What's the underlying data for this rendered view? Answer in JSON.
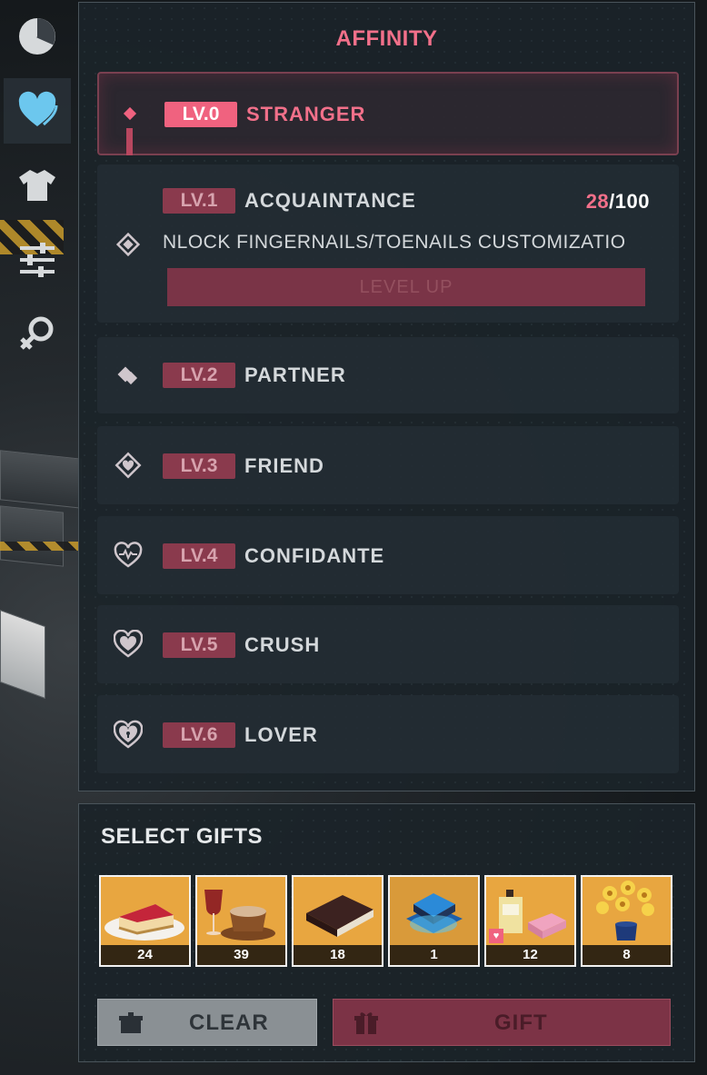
{
  "panel": {
    "title": "AFFINITY",
    "progress": {
      "current": "28",
      "max": "/100"
    },
    "levels": [
      {
        "badge": "LV.0",
        "name": "STRANGER",
        "icon": "diamond-dot-icon",
        "current": true
      },
      {
        "badge": "LV.1",
        "name": "ACQUAINTANCE",
        "icon": "diamond-icon",
        "unlock": "NLOCK FINGERNAILS/TOENAILS CUSTOMIZATIO",
        "button": "LEVEL UP"
      },
      {
        "badge": "LV.2",
        "name": "PARTNER",
        "icon": "split-diamond-icon"
      },
      {
        "badge": "LV.3",
        "name": "FRIEND",
        "icon": "heart-diamond-icon"
      },
      {
        "badge": "LV.4",
        "name": "CONFIDANTE",
        "icon": "heartbeat-icon"
      },
      {
        "badge": "LV.5",
        "name": "CRUSH",
        "icon": "double-heart-icon"
      },
      {
        "badge": "LV.6",
        "name": "LOVER",
        "icon": "heart-lock-icon"
      }
    ]
  },
  "sidebar": {
    "items": [
      {
        "icon": "pie-chart-icon"
      },
      {
        "icon": "heart-icon",
        "active": true
      },
      {
        "icon": "shirt-icon"
      },
      {
        "icon": "sliders-icon"
      },
      {
        "icon": "gender-icon"
      }
    ]
  },
  "gifts": {
    "title": "SELECT GIFTS",
    "items": [
      {
        "name": "cheesecake",
        "count": "24"
      },
      {
        "name": "coffee-and-wine",
        "count": "39"
      },
      {
        "name": "book",
        "count": "18"
      },
      {
        "name": "chip",
        "count": "1"
      },
      {
        "name": "perfume",
        "count": "12",
        "favorite": true
      },
      {
        "name": "flowers",
        "count": "8"
      }
    ],
    "clear_label": "CLEAR",
    "gift_label": "GIFT"
  },
  "colors": {
    "accent": "#f2708a",
    "badge": "#8a3a4d",
    "panel": "#1b2329"
  }
}
